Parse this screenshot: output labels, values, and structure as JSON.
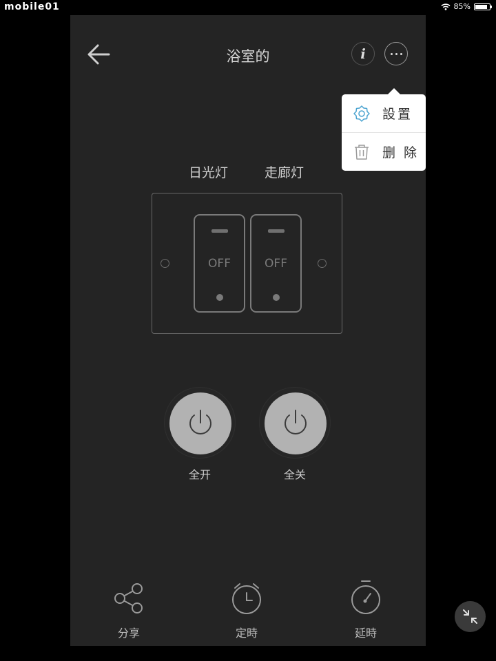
{
  "status_bar": {
    "left_text": "mobile01",
    "battery_text": "85%",
    "battery_level": 0.85
  },
  "header": {
    "title": "浴室的",
    "back_icon": "arrow-left-icon",
    "info_label": "i",
    "more_icon": "more-horizontal-icon"
  },
  "menu": {
    "items": [
      {
        "label": "設置",
        "icon": "gear-icon"
      },
      {
        "label": "删 除",
        "icon": "trash-icon"
      }
    ]
  },
  "switches": [
    {
      "name": "日光灯",
      "state": "OFF"
    },
    {
      "name": "走廊灯",
      "state": "OFF"
    }
  ],
  "power_buttons": [
    {
      "label": "全开",
      "icon": "power-icon"
    },
    {
      "label": "全关",
      "icon": "power-icon"
    }
  ],
  "actions": [
    {
      "label": "分享",
      "icon": "share-icon"
    },
    {
      "label": "定時",
      "icon": "alarm-clock-icon"
    },
    {
      "label": "延時",
      "icon": "stopwatch-icon"
    }
  ],
  "floating_button": {
    "icon": "collapse-icon"
  },
  "colors": {
    "background": "#242424",
    "text": "#d6d6d6",
    "button_fill": "#b2b2b2",
    "menu_accent": "#4aa3d0"
  }
}
